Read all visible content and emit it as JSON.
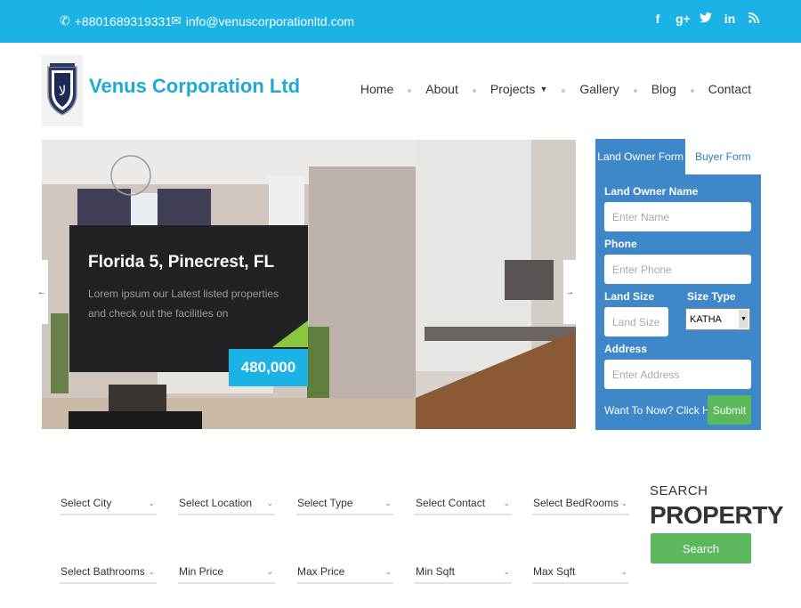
{
  "topbar": {
    "phone": "+8801689319331",
    "email": "info@venuscorporationltd.com",
    "social_icons": [
      "facebook-icon",
      "google-plus-icon",
      "twitter-icon",
      "linkedin-icon",
      "rss-icon"
    ]
  },
  "brand": {
    "name": "Venus Corporation Ltd"
  },
  "nav": {
    "home": "Home",
    "about": "About",
    "projects": "Projects",
    "gallery": "Gallery",
    "blog": "Blog",
    "contact": "Contact"
  },
  "slider": {
    "title": "Florida 5, Pinecrest, FL",
    "description": "Lorem ipsum our Latest listed properties and check out the facilities on",
    "price": "480,000"
  },
  "form": {
    "tab_land_owner": "Land Owner Form",
    "tab_buyer": "Buyer Form",
    "name_label": "Land Owner Name",
    "name_placeholder": "Enter Name",
    "phone_label": "Phone",
    "phone_placeholder": "Enter Phone",
    "land_size_label": "Land Size",
    "land_size_placeholder": "Land Size",
    "size_type_label": "Size Type",
    "size_type_value": "KATHA",
    "address_label": "Address",
    "address_placeholder": "Enter Address",
    "question": "Want To Now? Click Here",
    "submit": "Submit"
  },
  "search": {
    "row1": [
      "Select City",
      "Select Location",
      "Select Type",
      "Select Contact",
      "Select BedRooms"
    ],
    "row2": [
      "Select Bathrooms",
      "Min Price",
      "Max Price",
      "Min Sqft",
      "Max Sqft"
    ],
    "title_small": "SEARCH",
    "title_big": "PROPERTY",
    "button": "Search"
  },
  "colors": {
    "accent": "#1bb3e6",
    "form_bg": "#3e87c9",
    "button_green": "#5cb85c",
    "caption_bg": "#222224"
  }
}
